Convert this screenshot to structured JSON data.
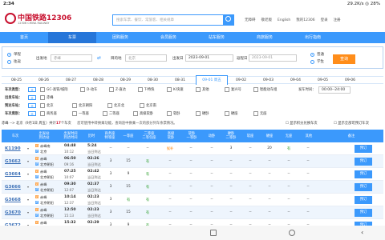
{
  "status": {
    "time": "2:34",
    "right": "29.2K/s  ◎  28%"
  },
  "header": {
    "logo_text": "中国铁路12306",
    "logo_sub": "12306 CHINA RAILWAY",
    "search_placeholder": "搜索车票、餐饮、常旅客、相关规章",
    "links": [
      "无障碍",
      "敬老版",
      "English",
      "我的12306",
      "登录",
      "注册"
    ]
  },
  "nav": [
    "首页",
    "车票",
    "团购服务",
    "会员服务",
    "站车服务",
    "商旅服务",
    "出行指南"
  ],
  "query": {
    "type_single": "单程",
    "type_round": "往返",
    "from_label": "出发地",
    "from_val": "赤峰",
    "to_label": "目的地",
    "to_val": "北京",
    "date_label": "出发日",
    "date_val": "2023-09-01",
    "ret_label": "返程日",
    "ret_val": "2023-09-01",
    "psg_normal": "普通",
    "psg_student": "学生",
    "btn": "查询"
  },
  "dates": [
    "08-25",
    "08-26",
    "08-27",
    "08-28",
    "08-29",
    "08-30",
    "08-31",
    "09-01 周五",
    "09-02",
    "09-03",
    "09-04",
    "09-05",
    "09-06"
  ],
  "filter": {
    "rows": [
      {
        "head": "车次类型：",
        "items": [
          "全部",
          "GC-高铁/城际",
          "D-动车",
          "Z-直达",
          "T-特快",
          "K-快速",
          "其他",
          "复兴号",
          "智能动车组"
        ],
        "extra_label": "发车时间：",
        "extra_val": "00:00--24:00"
      },
      {
        "head": "出发车站：",
        "items": [
          "全部",
          "赤峰"
        ]
      },
      {
        "head": "到达车站：",
        "items": [
          "全部",
          "北京",
          "北京朝阳",
          "北京北",
          "北京南"
        ]
      },
      {
        "head": "车次席别：",
        "items": [
          "全部",
          "商务座",
          "一等座",
          "二等座",
          "高级软卧",
          "软卧",
          "硬卧",
          "硬座",
          "无座"
        ]
      }
    ],
    "quan": "全"
  },
  "info": {
    "route": "赤峰 --> 北京（9月1日 周五）共计",
    "count": "17",
    "suffix": "个车次",
    "tip1": "您可使用中转换乘功能，查询途中换乘一次的部分列车余票情况。",
    "check1": "显示积分兑换车次",
    "check2": "显示全部可预订车次"
  },
  "columns": [
    "车次",
    "出发站\n到达站",
    "出发时间\n到达时间",
    "历时",
    "商务座\n特等座",
    "一等座",
    "二等座\n二等包座",
    "高级\n软卧",
    "软卧\n一等卧",
    "动卧",
    "硬卧\n二等卧",
    "软座",
    "硬座",
    "无座",
    "其他",
    "备注"
  ],
  "trains": [
    {
      "code": "K1190",
      "from": "赤峰南",
      "to": "北京",
      "t1": "04:48",
      "t2": "10:12",
      "d1": "5:24",
      "d2": "当日到达",
      "cells": [
        "--",
        "--",
        "--",
        "候补",
        "--",
        "--",
        "3",
        "--",
        "20",
        "有",
        "--"
      ],
      "btn": "预订"
    },
    {
      "code": "G3662",
      "from": "赤峰",
      "to": "北京朝阳",
      "t1": "06:50",
      "t2": "09:16",
      "d1": "02:26",
      "d2": "当日到达",
      "cells": [
        "3",
        "15",
        "有",
        "--",
        "--",
        "--",
        "--",
        "--",
        "--",
        "--",
        "--"
      ],
      "btn": "预订"
    },
    {
      "code": "G3664",
      "from": "赤峰",
      "to": "北京朝阳",
      "t1": "07:25",
      "t2": "10:07",
      "d1": "02:42",
      "d2": "当日到达",
      "cells": [
        "3",
        "9",
        "有",
        "--",
        "--",
        "--",
        "--",
        "--",
        "--",
        "--",
        "--"
      ],
      "btn": "预订"
    },
    {
      "code": "G3666",
      "from": "赤峰",
      "to": "北京朝阳",
      "t1": "09:30",
      "t2": "12:07",
      "d1": "02:37",
      "d2": "当日到达",
      "cells": [
        "3",
        "15",
        "有",
        "--",
        "--",
        "--",
        "--",
        "--",
        "--",
        "--",
        "--"
      ],
      "btn": "预订"
    },
    {
      "code": "G3668",
      "from": "赤峰",
      "to": "北京朝阳",
      "t1": "10:14",
      "t2": "12:37",
      "d1": "02:23",
      "d2": "当日到达",
      "cells": [
        "3",
        "有",
        "有",
        "--",
        "--",
        "--",
        "--",
        "--",
        "--",
        "--",
        "--"
      ],
      "btn": "预订"
    },
    {
      "code": "G3670",
      "from": "赤峰",
      "to": "北京朝阳",
      "t1": "12:50",
      "t2": "15:13",
      "d1": "02:23",
      "d2": "当日到达",
      "cells": [
        "3",
        "15",
        "有",
        "--",
        "--",
        "--",
        "--",
        "--",
        "--",
        "--",
        "--"
      ],
      "btn": "预订"
    },
    {
      "code": "G3672",
      "from": "赤峰",
      "to": "北京朝阳",
      "t1": "15:32",
      "t2": "18:01",
      "d1": "02:29",
      "d2": "当日到达",
      "cells": [
        "3",
        "9",
        "有",
        "--",
        "--",
        "--",
        "--",
        "--",
        "--",
        "--",
        "--"
      ],
      "btn": "预订"
    }
  ]
}
